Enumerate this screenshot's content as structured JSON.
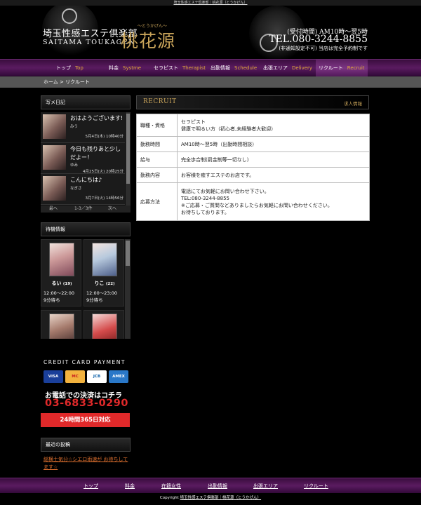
{
  "top_strip": "埼玉性感エステ倶楽部｜桃花源（とうかげん）",
  "logo": {
    "tagline": "埼玉性感エステ倶楽部",
    "en": "SAITAMA TOUKAGEN",
    "ruby": "～とうかげん～",
    "name": "桃花源"
  },
  "contact": {
    "hours": "(受付時間) AM10時～翌5時",
    "tel": "TEL.080-3244-8855",
    "note": "(非通知設定不可) 当店は完全予約制です"
  },
  "nav": [
    {
      "ja": "トップ",
      "en": "Top"
    },
    {
      "ja": "料金",
      "en": "Systme"
    },
    {
      "ja": "セラピスト",
      "en": "Therapist"
    },
    {
      "ja": "出勤情報",
      "en": "Schedule"
    },
    {
      "ja": "出張エリア",
      "en": "Delivery"
    },
    {
      "ja": "リクルート",
      "en": "Recruit"
    }
  ],
  "breadcrumb": "ホーム > リクルート",
  "blog": {
    "title": "写メ日記",
    "entries": [
      {
        "title": "おはようございます!",
        "author": "みう",
        "date": "5月4日(木) 10時40分"
      },
      {
        "title": "今日も残りあと少しだよー！",
        "author": "ゆみ",
        "date": "4月25日(火) 20時25分"
      },
      {
        "title": "こんにちは♪",
        "author": "なぎさ",
        "date": "3月7日(火) 14時56分"
      }
    ],
    "pager": {
      "prev": "最へ",
      "count": "1-3／3件",
      "next": "次へ"
    }
  },
  "waiting": {
    "title": "待機情報",
    "therapists": [
      {
        "name": "るい",
        "age": "(19)",
        "hours": "12:00～22:00",
        "wait": "9分待ち"
      },
      {
        "name": "りこ",
        "age": "(22)",
        "hours": "12:00～23:00",
        "wait": "9分待ち"
      }
    ]
  },
  "payment": {
    "title": "CREDIT CARD PAYMENT",
    "cards": [
      "VISA",
      "MC",
      "JCB",
      "AMEX"
    ],
    "phone_label": "お電話での決済はコチラ",
    "phone": "03-6833-0290",
    "band": "24時間365日対応"
  },
  "recent": {
    "title": "最近の投稿",
    "link": "総横土気分☆シエロ雨速が お待ちしてます☆"
  },
  "recruit": {
    "title_en": "RECRUIT",
    "title_ja": "求人情報",
    "rows": [
      {
        "key": "職種・資格",
        "lines": [
          "セラピスト",
          "健康で明るい方（初心者,未経験者大歓迎）"
        ]
      },
      {
        "key": "勤務時間",
        "lines": [
          "AM10時～翌5時（出勤時間相談）"
        ]
      },
      {
        "key": "給与",
        "lines": [
          "完全歩合制(罰金制等一切なし)"
        ]
      },
      {
        "key": "勤務内容",
        "lines": [
          "お客様を癒すエステのお店です。"
        ]
      },
      {
        "key": "応募方法",
        "lines": [
          "電話にてお気軽にお問い合わせ下さい。",
          "TEL:080-3244-8855",
          "※ご応募・ご質問などありましたらお気軽にお問い合わせください。",
          "お待ちしております。"
        ]
      }
    ]
  },
  "footer": {
    "links": [
      "トップ",
      "料金",
      "在籍女性",
      "出勤情報",
      "出張エリア",
      "リクルート"
    ],
    "copyright_prefix": "Copyright",
    "copyright_link": "埼玉性感エステ倶楽部｜桃花源（とうかげん）"
  },
  "colors": {
    "accent_gold": "#c9a45a",
    "nav_purple": "#5a1b60",
    "link_orange": "#e0712f",
    "alert_red": "#e0292a"
  }
}
